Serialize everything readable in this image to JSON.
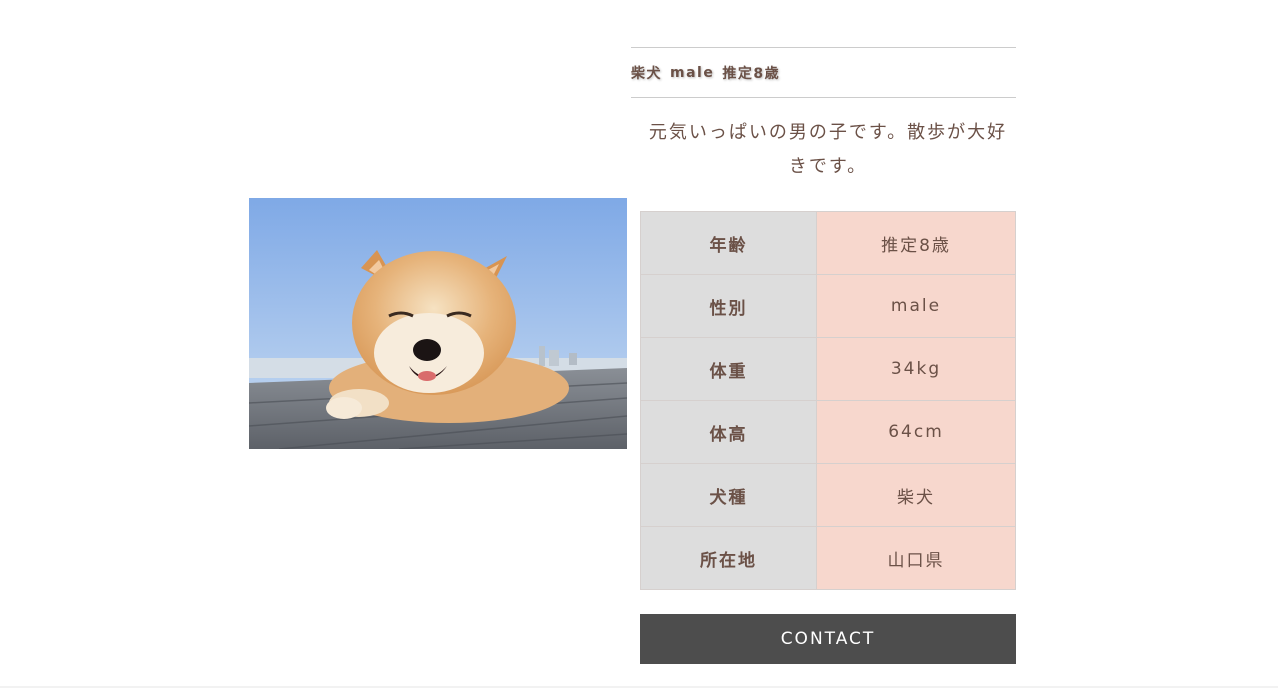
{
  "heading": {
    "breed": "柴犬",
    "gender": "male",
    "age": "推定8歳"
  },
  "description": "元気いっぱいの男の子です。散歩が大好きです。",
  "photo": {
    "icon": "shiba-dog-photo"
  },
  "profile": {
    "rows": [
      {
        "label": "年齢",
        "value": "推定8歳"
      },
      {
        "label": "性別",
        "value": "male"
      },
      {
        "label": "体重",
        "value": "34kg"
      },
      {
        "label": "体高",
        "value": "64cm"
      },
      {
        "label": "犬種",
        "value": "柴犬"
      },
      {
        "label": "所在地",
        "value": "山口県"
      }
    ]
  },
  "contact_button": {
    "label": "CONTACT"
  },
  "colors": {
    "text": "#6b5147",
    "label_bg": "#dddddd",
    "value_bg": "#f7d7cd",
    "button_bg": "#4d4d4d"
  }
}
